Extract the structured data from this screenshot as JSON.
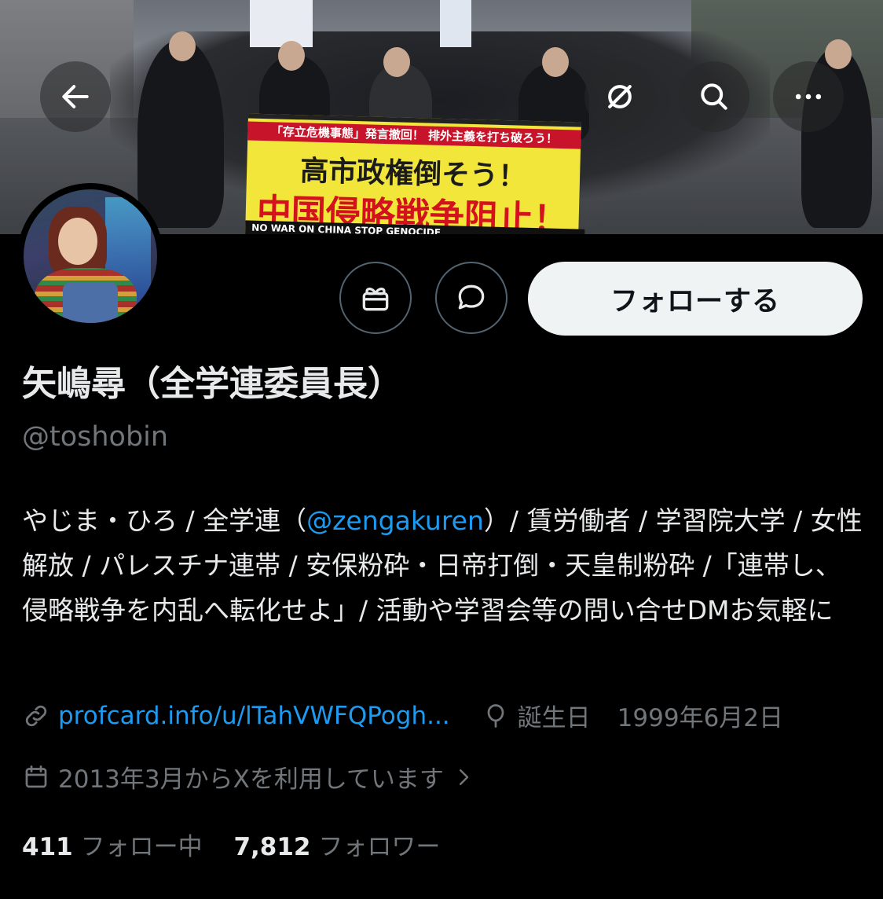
{
  "banner": {
    "sign_top": "「存立危機事態」発言撤回！ 排外主義を打ち破ろう！",
    "sign_line1": "高市政権倒そう！",
    "sign_line2": "中国侵略戦争阻止！",
    "sign_bottom": "NO WAR ON CHINA  STOP GENOCIDE"
  },
  "header": {
    "back_icon": "arrow-left-icon",
    "grok_icon": "slash-circle-icon",
    "search_icon": "search-icon",
    "more_icon": "more-horizontal-icon"
  },
  "actions": {
    "gift_icon": "gift-icon",
    "message_icon": "message-icon",
    "follow_label": "フォローする"
  },
  "profile": {
    "display_name": "矢嶋尋（全学連委員長）",
    "handle": "@toshobin",
    "bio_part1": "やじま・ひろ / 全学連（",
    "bio_mention": "@zengakuren",
    "bio_part2": "）/ 賃労働者 / 学習院大学 / 女性解放 / パレスチナ連帯 / 安保粉砕・日帝打倒・天皇制粉砕 /「連帯し、侵略戦争を内乱へ転化せよ」/ 活動や学習会等の問い合せDMお気軽に",
    "link": "profcard.info/u/lTahVWFQPogh...",
    "birthday_label": "誕生日",
    "birthday_value": "1999年6月2日",
    "joined": "2013年3月からXを利用しています",
    "following_count": "411",
    "following_label": "フォロー中",
    "followers_count": "7,812",
    "followers_label": "フォロワー"
  },
  "colors": {
    "accent": "#1d9bf0",
    "muted": "#71767b",
    "text": "#e7e9ea",
    "button_bg": "#eff3f4"
  }
}
